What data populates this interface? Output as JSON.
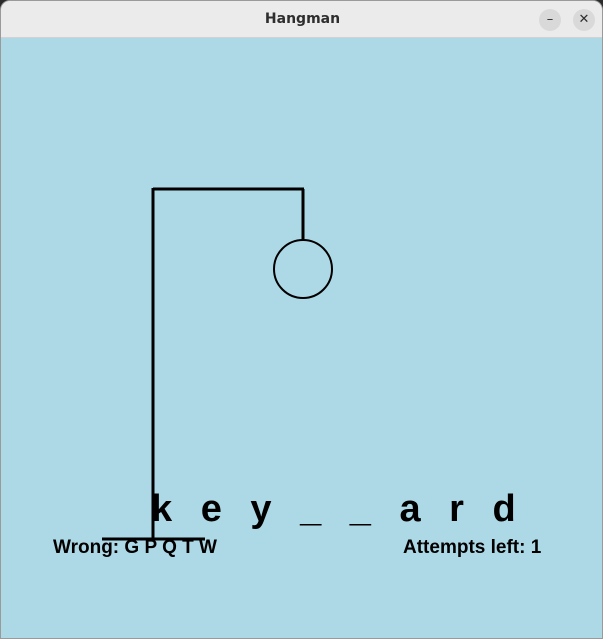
{
  "window": {
    "title": "Hangman",
    "minimize_glyph": "–",
    "close_glyph": "✕"
  },
  "game": {
    "word_display": "k e y _ _ a r d",
    "wrong_label": "Wrong:",
    "wrong_letters": "G P Q T W",
    "attempts_label": "Attempts left:",
    "attempts_left": "1",
    "drawn_parts": [
      "gallows-base",
      "gallows-post",
      "gallows-beam",
      "rope",
      "head"
    ]
  },
  "colors": {
    "background": "#add8e6",
    "ink": "#000000"
  }
}
